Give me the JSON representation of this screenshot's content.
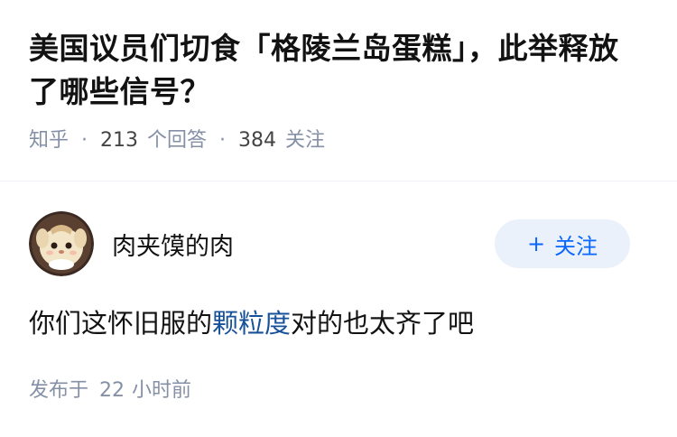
{
  "question": {
    "title": "美国议员们切食「格陵兰岛蛋糕」，此举释放了哪些信号？",
    "source": "知乎",
    "answer_count": "213",
    "answer_label": "个回答",
    "follower_count": "384",
    "follower_label": "关注"
  },
  "answer": {
    "author_name": "肉夹馍的肉",
    "follow_label": "关注",
    "body_before": "你们这怀旧服的",
    "body_link": "颗粒度",
    "body_after": "对的也太齐了吧",
    "published_prefix": "发布于",
    "published_num": "22",
    "published_unit": "小时前"
  },
  "colors": {
    "accent": "#0966ff",
    "link": "#175199",
    "meta": "#8590a6",
    "follow_bg": "#eaf1fb"
  },
  "icons": {
    "follow": "plus-icon",
    "avatar": "cartoon-avatar"
  }
}
